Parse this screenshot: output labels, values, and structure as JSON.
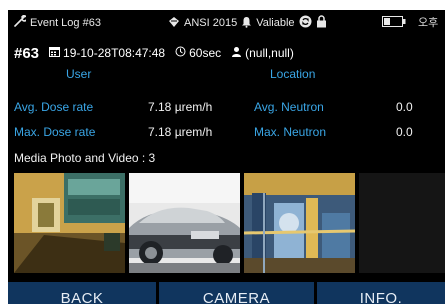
{
  "status_bar": {
    "app_title": "Event Log #63",
    "standard": "ANSI 2015",
    "alarm_state": "Valiable",
    "signal_text": "오후"
  },
  "event": {
    "number": "#63",
    "timestamp": "19-10-28T08:47:48",
    "duration": "60sec",
    "location_coords": "(null,null)"
  },
  "headers": {
    "user": "User",
    "location": "Location"
  },
  "measurements": {
    "avg_dose_label": "Avg. Dose rate",
    "avg_dose_value": "7.18  µrem/h",
    "max_dose_label": "Max. Dose rate",
    "max_dose_value": "7.18  µrem/h",
    "avg_neutron_label": "Avg. Neutron",
    "avg_neutron_value": "0.0",
    "max_neutron_label": "Max. Neutron",
    "max_neutron_value": "0.0"
  },
  "media": {
    "label": "Media Photo and Video : 3"
  },
  "buttons": {
    "back": "BACK",
    "camera": "CAMERA",
    "info": "INFO."
  },
  "colors": {
    "accent_label": "#3aa6e6",
    "button_bg": "#10355e",
    "background": "#000000"
  }
}
